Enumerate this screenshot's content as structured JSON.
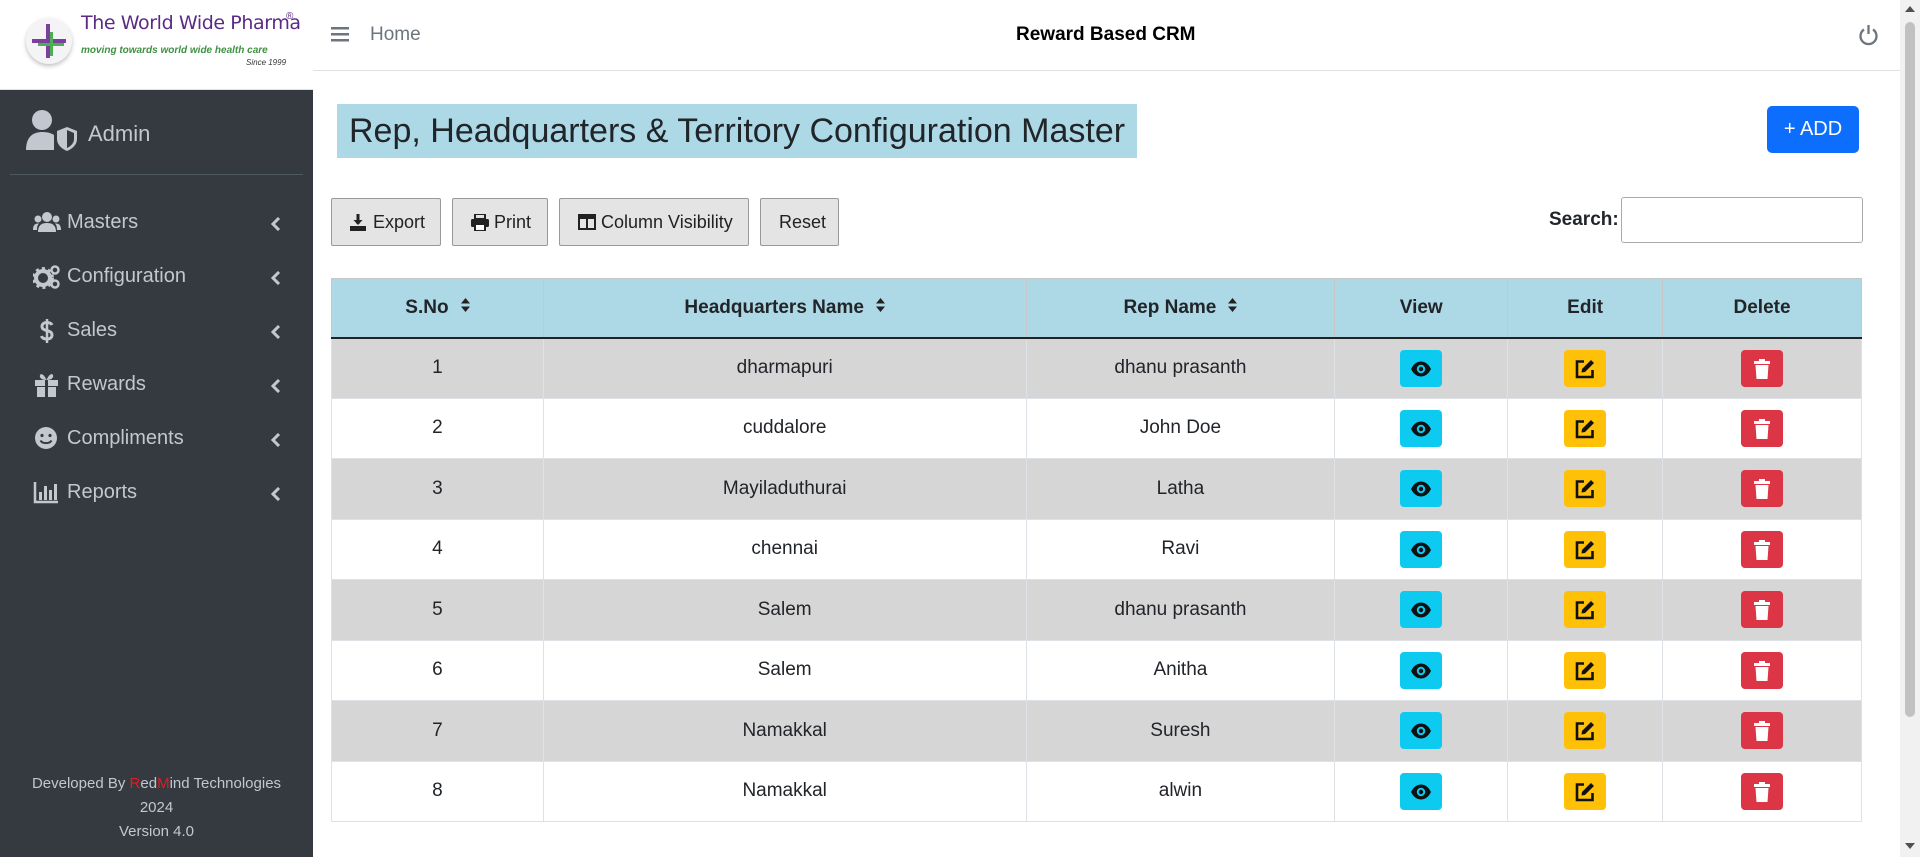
{
  "brand": {
    "name": "The World Wide Pharma",
    "registered": "®",
    "tagline": "moving towards world wide health care",
    "since": "Since 1999"
  },
  "user": {
    "name": "Admin"
  },
  "nav": [
    {
      "label": "Masters",
      "icon": "users-icon"
    },
    {
      "label": "Configuration",
      "icon": "gears-icon"
    },
    {
      "label": "Sales",
      "icon": "dollar-icon"
    },
    {
      "label": "Rewards",
      "icon": "gift-icon"
    },
    {
      "label": "Compliments",
      "icon": "smile-icon"
    },
    {
      "label": "Reports",
      "icon": "bar-chart-icon"
    }
  ],
  "footer": {
    "developed_by": "Developed By",
    "r": "R",
    "ed": "ed",
    "m": "M",
    "ind": "ind Technologies",
    "year": "2024",
    "version": "Version 4.0"
  },
  "topbar": {
    "home": "Home",
    "title": "Reward Based CRM"
  },
  "page": {
    "title": "Rep, Headquarters & Territory Configuration Master",
    "add_label": "+ ADD"
  },
  "toolbar": {
    "export": "Export",
    "print": "Print",
    "column_visibility": "Column Visibility",
    "reset": "Reset"
  },
  "search": {
    "label": "Search:",
    "value": ""
  },
  "table": {
    "headers": [
      "S.No",
      "Headquarters Name",
      "Rep Name",
      "View",
      "Edit",
      "Delete"
    ],
    "rows": [
      {
        "sno": "1",
        "hq": "dharmapuri",
        "rep": "dhanu prasanth"
      },
      {
        "sno": "2",
        "hq": "cuddalore",
        "rep": "John Doe"
      },
      {
        "sno": "3",
        "hq": "Mayiladuthurai",
        "rep": "Latha"
      },
      {
        "sno": "4",
        "hq": "chennai",
        "rep": "Ravi"
      },
      {
        "sno": "5",
        "hq": "Salem",
        "rep": "dhanu prasanth"
      },
      {
        "sno": "6",
        "hq": "Salem",
        "rep": "Anitha"
      },
      {
        "sno": "7",
        "hq": "Namakkal",
        "rep": "Suresh"
      },
      {
        "sno": "8",
        "hq": "Namakkal",
        "rep": "alwin"
      }
    ]
  },
  "colors": {
    "sidebar": "#343a40",
    "header_bg": "#add8e6",
    "primary": "#0d6efd",
    "view": "#0dcaf0",
    "edit": "#ffc107",
    "delete": "#dc3545"
  }
}
